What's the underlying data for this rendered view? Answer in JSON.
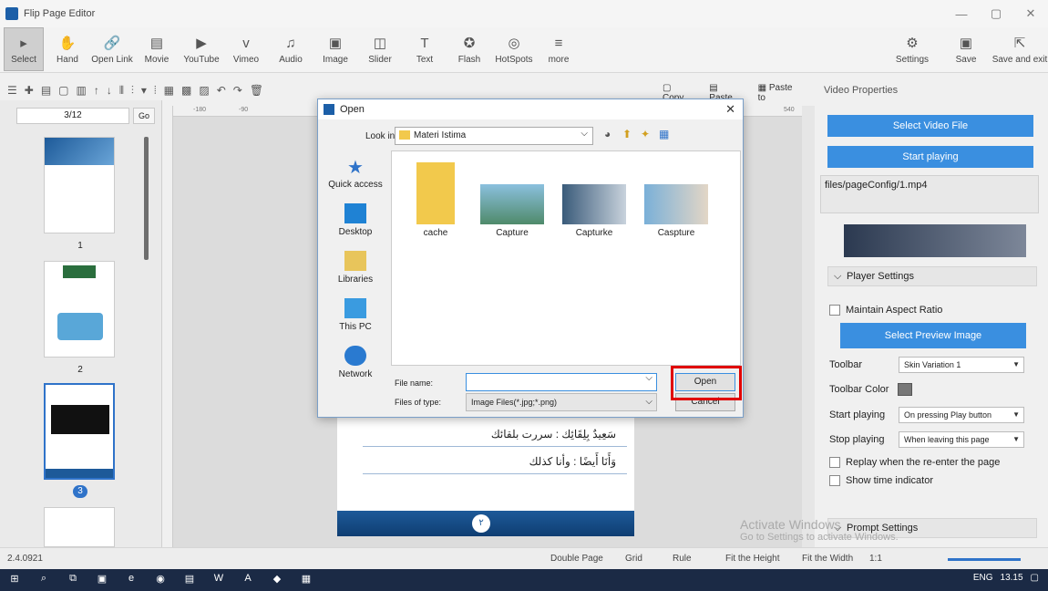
{
  "window": {
    "title": "Flip Page Editor",
    "minimize": "—",
    "maximize": "▢",
    "close": "✕"
  },
  "toolbar": {
    "tools": [
      {
        "label": "Select",
        "icon": "▸",
        "name": "select"
      },
      {
        "label": "Hand",
        "icon": "✋",
        "name": "hand"
      },
      {
        "label": "Open Link",
        "icon": "🔗",
        "name": "open-link"
      },
      {
        "label": "Movie",
        "icon": "▤",
        "name": "movie"
      },
      {
        "label": "YouTube",
        "icon": "▶",
        "name": "youtube"
      },
      {
        "label": "Vimeo",
        "icon": "v",
        "name": "vimeo"
      },
      {
        "label": "Audio",
        "icon": "♫",
        "name": "audio"
      },
      {
        "label": "Image",
        "icon": "▣",
        "name": "image"
      },
      {
        "label": "Slider",
        "icon": "◫",
        "name": "slider"
      },
      {
        "label": "Text",
        "icon": "T",
        "name": "text"
      },
      {
        "label": "Flash",
        "icon": "✪",
        "name": "flash"
      },
      {
        "label": "HotSpots",
        "icon": "◎",
        "name": "hotspots"
      },
      {
        "label": "more",
        "icon": "≡",
        "name": "more"
      }
    ],
    "right": [
      {
        "label": "Settings",
        "icon": "⚙",
        "name": "settings"
      },
      {
        "label": "Save",
        "icon": "▣",
        "name": "save"
      },
      {
        "label": "Save and exit",
        "icon": "⇱",
        "name": "save-exit"
      }
    ]
  },
  "editbar": {
    "copy": "Copy",
    "paste": "Paste",
    "paste_to": "Paste to"
  },
  "pages": {
    "current": "3/12",
    "go": "Go",
    "thumb_labels": [
      "1",
      "2",
      "3"
    ]
  },
  "ruler": {
    "marks": [
      "-180",
      "-90",
      "540"
    ]
  },
  "page_text": {
    "line1": "سَعِيدٌ بِلِقَائِك  :  سررت بلقائك",
    "line2": "وَأَنَا أَيضًا     :  وأنا كذلك",
    "page_number": "٢"
  },
  "right_panel": {
    "header": "Video Properties",
    "select_video": "Select Video File",
    "start_playing_btn": "Start playing",
    "file_path": "files/pageConfig/1.mp4",
    "player_settings": "Player Settings",
    "maintain_aspect": "Maintain Aspect Ratio",
    "select_preview": "Select Preview Image",
    "toolbar_label": "Toolbar",
    "toolbar_value": "Skin Variation 1",
    "toolbar_color": "Toolbar Color",
    "start_label": "Start playing",
    "start_value": "On pressing Play button",
    "stop_label": "Stop playing",
    "stop_value": "When leaving this page",
    "replay": "Replay when the re-enter the page",
    "show_time": "Show time indicator",
    "prompt_settings": "Prompt Settings"
  },
  "watermark": {
    "line1": "Activate Windows",
    "line2": "Go to Settings to activate Windows."
  },
  "status": {
    "version": "2.4.0921",
    "double_page": "Double Page",
    "grid": "Grid",
    "rule": "Rule",
    "fit_height": "Fit the Height",
    "fit_width": "Fit the Width",
    "ratio": "1:1"
  },
  "dialog": {
    "title": "Open",
    "look_in_label": "Look in:",
    "look_in_value": "Materi Istima",
    "places": [
      "Quick access",
      "Desktop",
      "Libraries",
      "This PC",
      "Network"
    ],
    "files": [
      "cache",
      "Capture",
      "Capturke",
      "Caspture"
    ],
    "file_name_label": "File name:",
    "file_name_value": "",
    "files_of_type_label": "Files of type:",
    "files_of_type_value": "Image Files(*.jpg;*.png)",
    "open": "Open",
    "cancel": "Cancel"
  },
  "taskbar": {
    "lang": "ENG",
    "time": "13.15"
  },
  "colors": {
    "accent": "#3a8fe0",
    "highlight": "#e00000",
    "taskbar": "#1b2a45"
  }
}
